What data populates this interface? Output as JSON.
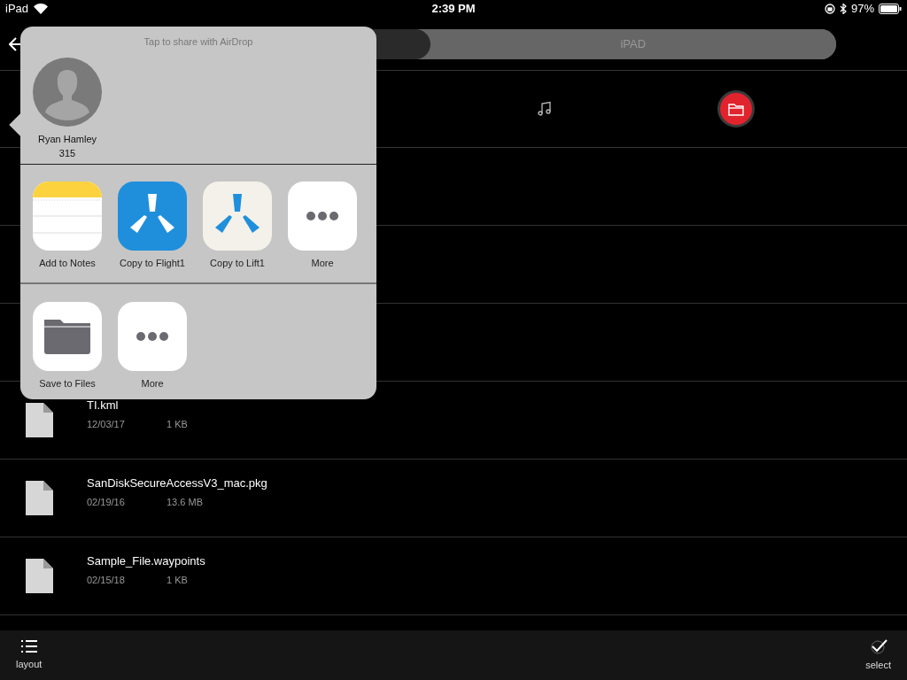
{
  "status_bar": {
    "device": "iPad",
    "time": "2:39 PM",
    "battery": "97%"
  },
  "segments": [
    {
      "selected": true
    },
    {
      "label": "iPAD",
      "selected": false
    }
  ],
  "tabs": [
    {
      "kind": "music",
      "selected": false
    },
    {
      "kind": "folder",
      "selected": true
    }
  ],
  "files": [
    {
      "name": "TI.kml",
      "date": "12/03/17",
      "size": "1 KB"
    },
    {
      "name": "SanDiskSecureAccessV3_mac.pkg",
      "date": "02/19/16",
      "size": "13.6 MB"
    },
    {
      "name": "Sample_File.waypoints",
      "date": "02/15/18",
      "size": "1 KB"
    }
  ],
  "share_sheet": {
    "airdrop_hint": "Tap to share with AirDrop",
    "contact": {
      "name": "Ryan Hamley",
      "detail": "315"
    },
    "apps": [
      {
        "kind": "notes",
        "label": "Add to Notes"
      },
      {
        "kind": "flight",
        "label": "Copy to Flight1"
      },
      {
        "kind": "lift",
        "label": "Copy to Lift1"
      },
      {
        "kind": "more",
        "label": "More"
      }
    ],
    "actions": [
      {
        "kind": "files",
        "label": "Save to Files"
      },
      {
        "kind": "more",
        "label": "More"
      }
    ]
  },
  "toolbar": [
    {
      "kind": "layout",
      "label": "layout"
    },
    {
      "kind": "select",
      "label": "select"
    }
  ]
}
